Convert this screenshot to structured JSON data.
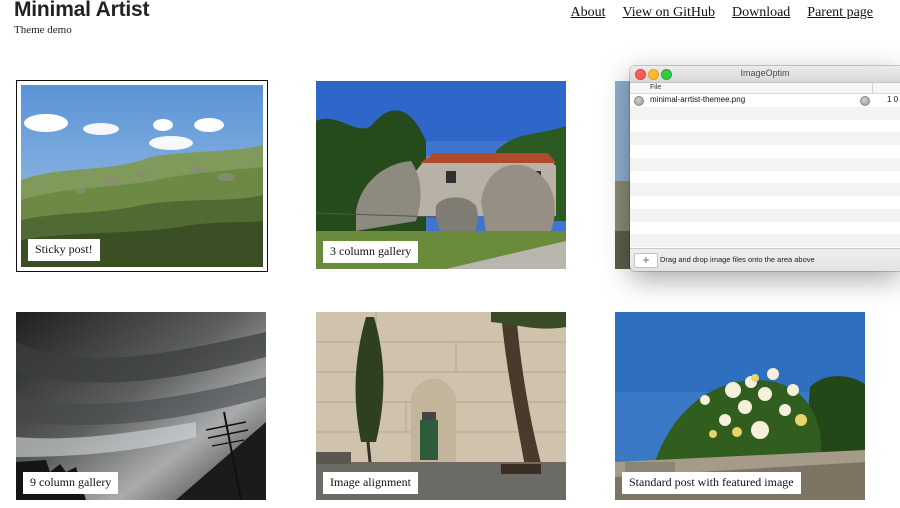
{
  "header": {
    "site_title": "Minimal Artist",
    "tagline": "Theme demo",
    "nav": [
      "About",
      "View on GitHub",
      "Download",
      "Parent page"
    ]
  },
  "posts": [
    {
      "label": "Sticky post!"
    },
    {
      "label": "3 column gallery"
    },
    {
      "label": ""
    },
    {
      "label": "9 column gallery"
    },
    {
      "label": "Image alignment"
    },
    {
      "label": "Standard post with featured image"
    }
  ],
  "imageoptim": {
    "title": "ImageOptim",
    "column_header": "File",
    "file_name": "minimal-arrtist-themee.png",
    "file_size": "1 0",
    "hint": "Drag and drop image files onto the area above",
    "add_button": "+"
  }
}
